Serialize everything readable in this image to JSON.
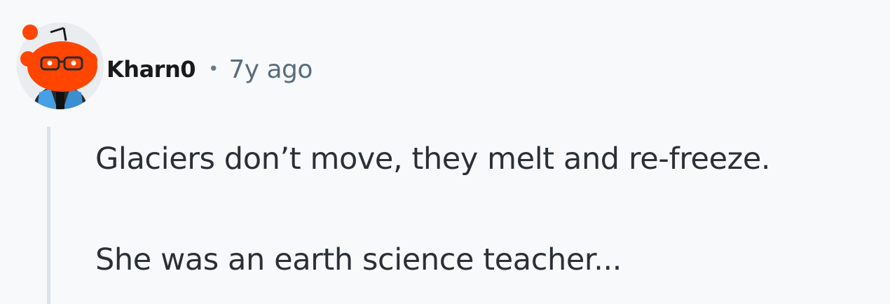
{
  "comment": {
    "author": "Kharn0",
    "separator": "•",
    "age": "7y ago",
    "paragraphs": [
      "Glaciers don’t move, they melt and re-freeze.",
      "She was an earth science teacher..."
    ]
  },
  "colors": {
    "background": "#f7f9fa",
    "thread_line": "#dbe1e6",
    "avatar_red": "#ff4500",
    "text": "#2a3036",
    "meta": "#5a6c7d"
  },
  "icons": {
    "avatar": "snoo-avatar-icon"
  }
}
